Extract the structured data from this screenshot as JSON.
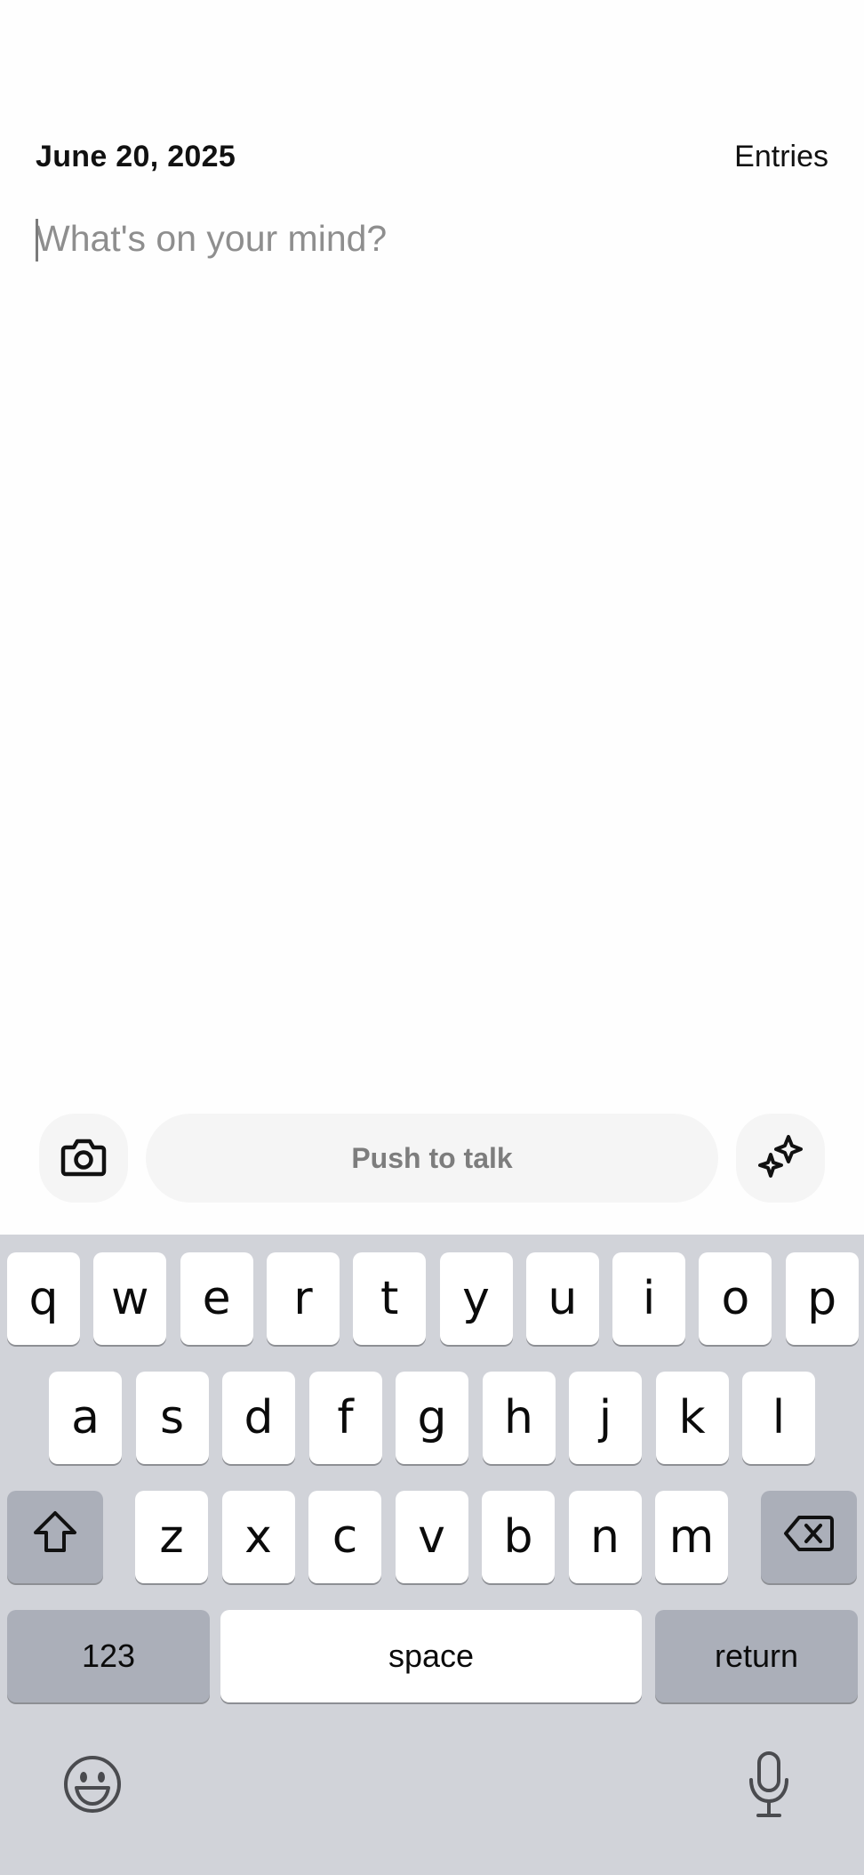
{
  "header": {
    "date": "June 20, 2025",
    "entries_label": "Entries"
  },
  "editor": {
    "placeholder": "What's on your mind?",
    "value": ""
  },
  "toolbar": {
    "camera_icon": "camera-icon",
    "push_to_talk_label": "Push to talk",
    "sparkle_icon": "sparkle-icon"
  },
  "keyboard": {
    "row1": [
      "q",
      "w",
      "e",
      "r",
      "t",
      "y",
      "u",
      "i",
      "o",
      "p"
    ],
    "row2": [
      "a",
      "s",
      "d",
      "f",
      "g",
      "h",
      "j",
      "k",
      "l"
    ],
    "row3": [
      "z",
      "x",
      "c",
      "v",
      "b",
      "n",
      "m"
    ],
    "numbers_label": "123",
    "space_label": "space",
    "return_label": "return",
    "shift_icon": "shift-icon",
    "backspace_icon": "backspace-icon",
    "emoji_icon": "emoji-icon",
    "dictation_icon": "microphone-icon"
  },
  "colors": {
    "keyboard_bg": "#d1d3d9",
    "key_light": "#ffffff",
    "key_dark": "#abafb9",
    "toolbar_bg": "#f5f5f5",
    "placeholder": "#8e8e8e"
  }
}
